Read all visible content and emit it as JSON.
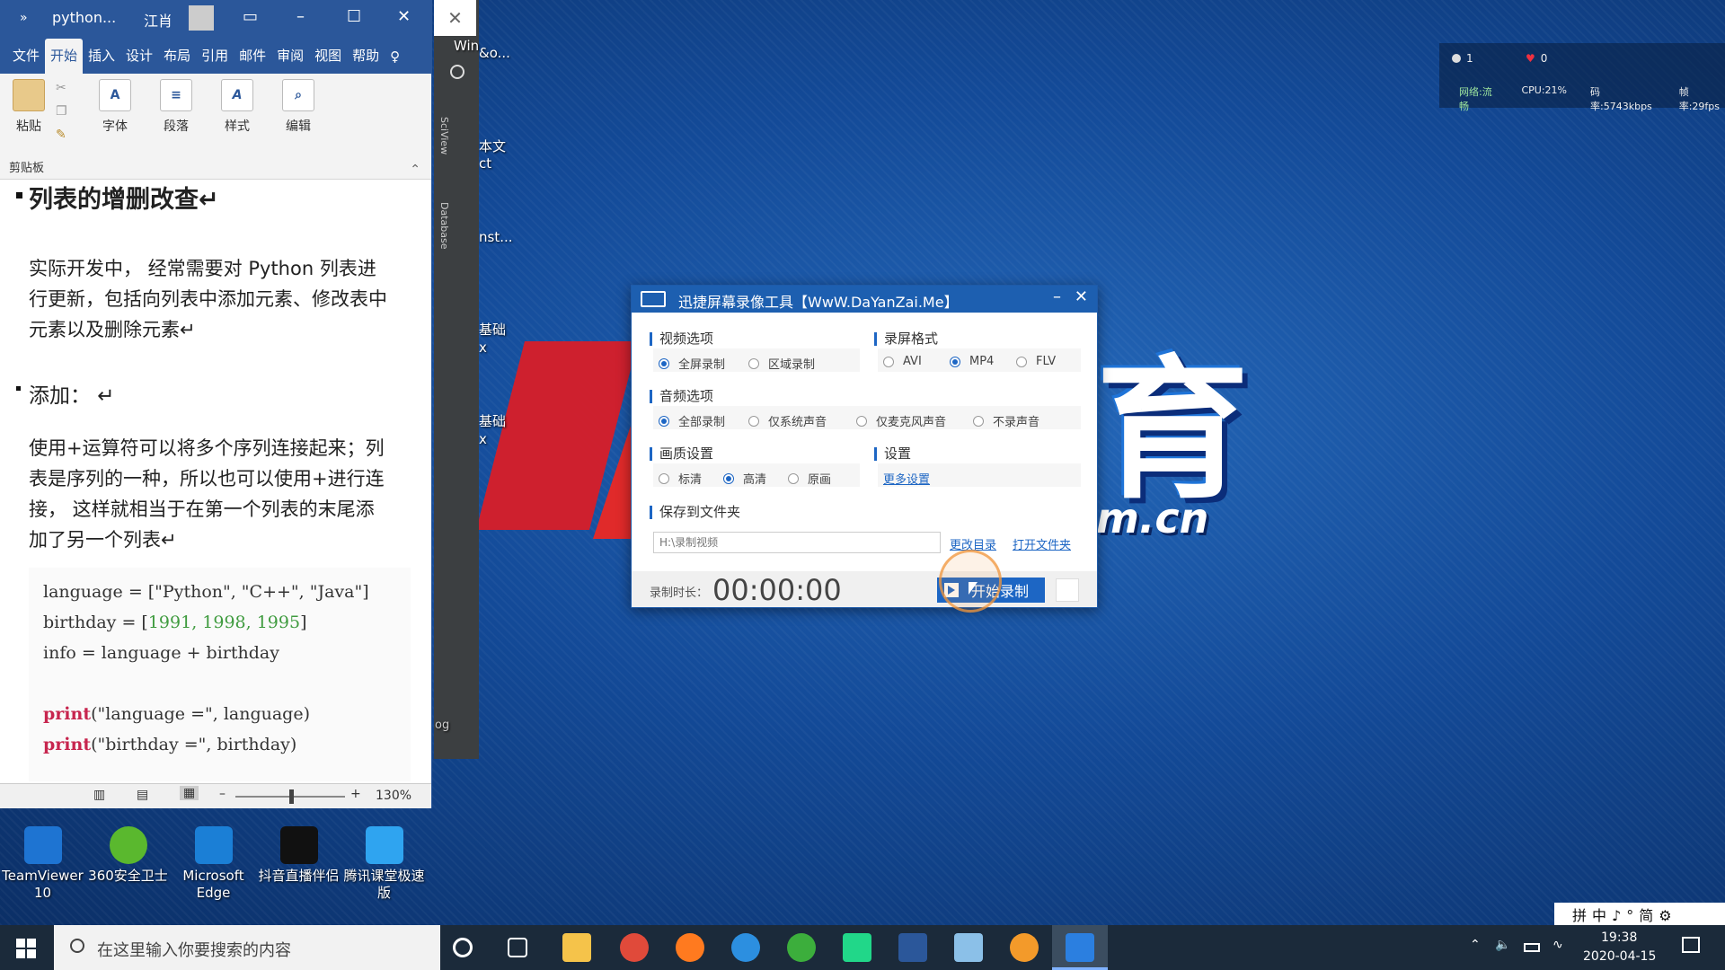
{
  "word": {
    "title": "python...",
    "user": "江肖",
    "tabs": [
      "文件",
      "开始",
      "插入",
      "设计",
      "布局",
      "引用",
      "邮件",
      "审阅",
      "视图",
      "帮助"
    ],
    "active_tab": "开始",
    "ribbon": {
      "paste": "粘贴",
      "font": "字体",
      "paragraph": "段落",
      "styles": "样式",
      "editing": "编辑",
      "clipboard": "剪贴板"
    },
    "heading": "列表的增删改查↵",
    "para1": "实际开发中， 经常需要对 Python 列表进行更新，包括向列表中添加元素、修改表中元素以及删除元素↵",
    "subheading": "添加：  ↵",
    "para2": "使用+运算符可以将多个序列连接起来；列表是序列的一种，所以也可以使用+进行连接， 这样就相当于在第一个列表的末尾添加了另一个列表↵",
    "code": {
      "line1_a": "language = [\"Python\", \"C++\", \"Java\"]",
      "line2_a": "birthday = [",
      "line2_n": "1991, 1998, 1995",
      "line2_b": "]",
      "line3": "info = language + birthday",
      "print1_kw": "print",
      "print1_rest": "(\"language =\", language)",
      "print2_kw": "print",
      "print2_rest": "(\"birthday =\", birthday)"
    },
    "zoom": "130%"
  },
  "background_window": {
    "labels": [
      "Win",
      "&o...",
      "本文",
      "ct",
      "nst...",
      "基础",
      "x",
      "基础",
      "x",
      "og"
    ],
    "side_tabs": [
      "SciView",
      "Database"
    ]
  },
  "recorder": {
    "title": "迅捷屏幕录像工具【WwW.DaYanZai.Me】",
    "video_section": "视频选项",
    "video_options": [
      "全屏录制",
      "区域录制"
    ],
    "format_section": "录屏格式",
    "format_options": [
      "AVI",
      "MP4",
      "FLV"
    ],
    "audio_section": "音频选项",
    "audio_options": [
      "全部录制",
      "仅系统声音",
      "仅麦克风声音",
      "不录声音"
    ],
    "quality_section": "画质设置",
    "quality_options": [
      "标清",
      "高清",
      "原画"
    ],
    "settings_section": "设置",
    "more_settings": "更多设置",
    "save_section": "保存到文件夹",
    "save_path_placeholder": "H:\\录制视频",
    "change_dir": "更改目录",
    "open_folder": "打开文件夹",
    "duration_label": "录制时长：",
    "duration": "00:00:00",
    "start_button": "开始录制",
    "selected": {
      "video": "全屏录制",
      "format": "MP4",
      "audio": "全部录制",
      "quality": "高清"
    }
  },
  "stats": {
    "viewers": "1",
    "likes": "0",
    "network": "网络:流畅",
    "cpu": "CPU:21%",
    "bitrate": "码率:5743kbps",
    "fps": "帧率:29fps"
  },
  "desktop_icons": [
    {
      "label": "TeamViewer 10",
      "icon": "teamviewer-icon",
      "color": "#1e74d2"
    },
    {
      "label": "360安全卫士",
      "icon": "360-icon",
      "color": "#5ab82e"
    },
    {
      "label": "Microsoft Edge",
      "icon": "edge-icon",
      "color": "#1b7fd6"
    },
    {
      "label": "抖音直播伴侣",
      "icon": "douyin-icon",
      "color": "#111111"
    },
    {
      "label": "腾讯课堂极速版",
      "icon": "tencent-classroom-icon",
      "color": "#2fa4f0"
    }
  ],
  "taskbar": {
    "search_placeholder": "在这里输入你要搜索的内容",
    "apps": [
      {
        "name": "cortana-icon",
        "color": "#ffffff"
      },
      {
        "name": "task-view-icon",
        "color": "#ffffff"
      },
      {
        "name": "file-explorer-icon",
        "color": "#f5c34a"
      },
      {
        "name": "chrome-icon",
        "color": "#e04a3a"
      },
      {
        "name": "firefox-icon",
        "color": "#ff7a1f"
      },
      {
        "name": "ie-icon",
        "color": "#2c8fe0"
      },
      {
        "name": "360-browser-icon",
        "color": "#3cae3c"
      },
      {
        "name": "pycharm-icon",
        "color": "#21d789"
      },
      {
        "name": "word-icon",
        "color": "#2b579a"
      },
      {
        "name": "paint-icon",
        "color": "#8bc0e8"
      },
      {
        "name": "fiddler-icon",
        "color": "#f39a2a"
      },
      {
        "name": "screen-recorder-icon",
        "color": "#2b7fe0"
      }
    ],
    "time": "19:38",
    "date": "2020-04-15",
    "ime": "拼中♪°简⚙"
  },
  "colors": {
    "word_blue": "#2b579a",
    "recorder_blue": "#1d66c4",
    "code_keyword": "#c7254e",
    "code_number": "#3f9b3f"
  }
}
